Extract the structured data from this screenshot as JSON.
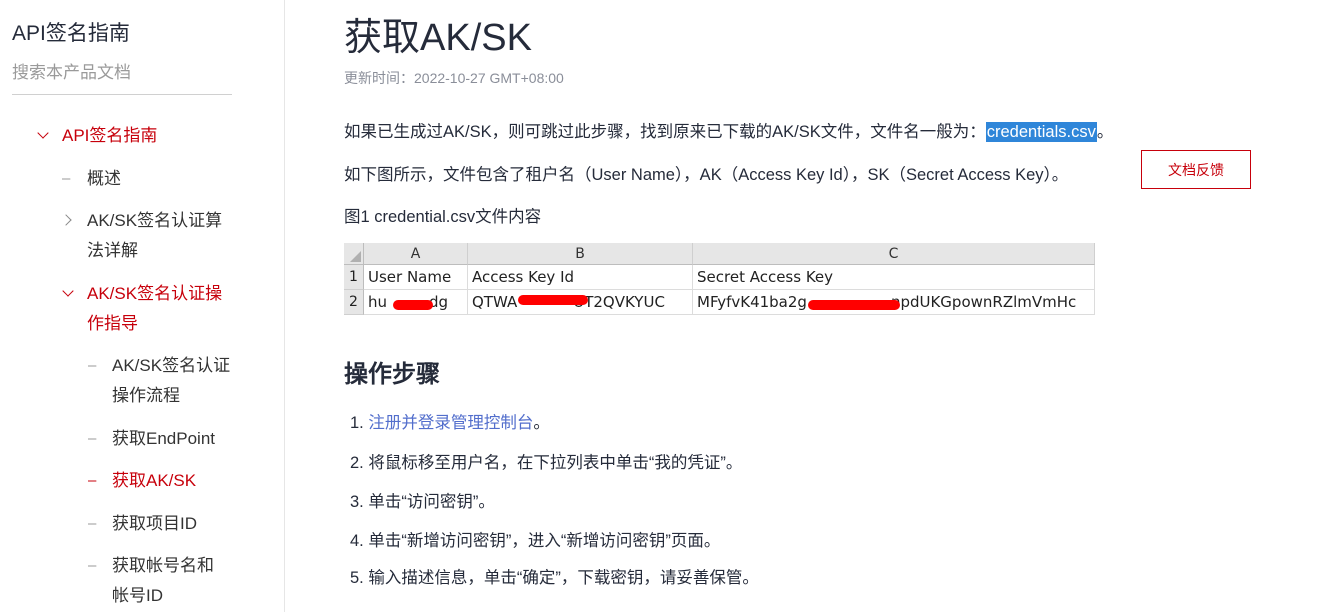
{
  "sidebar": {
    "title": "API签名指南",
    "search_placeholder": "搜索本产品文档",
    "items": [
      {
        "label": "API签名指南",
        "state": "expanded-active"
      },
      {
        "label": "概述"
      },
      {
        "label": "AK/SK签名认证算法详解",
        "line1": "AK/SK签名认证算",
        "line2": "法详解",
        "state": "collapsed"
      },
      {
        "label": "AK/SK签名认证操作指导",
        "line1": "AK/SK签名认证操",
        "line2": "作指导",
        "state": "expanded-active"
      },
      {
        "label": "AK/SK签名认证操作流程",
        "line1": "AK/SK签名认证",
        "line2": "操作流程"
      },
      {
        "label": "获取EndPoint"
      },
      {
        "label": "获取AK/SK",
        "state": "current"
      },
      {
        "label": "获取项目ID"
      },
      {
        "label": "获取帐号名和帐号ID",
        "line1": "获取帐号名和",
        "line2": "帐号ID"
      }
    ]
  },
  "main": {
    "title": "获取AK/SK",
    "updated": "更新时间：2022-10-27 GMT+08:00",
    "para1_before": "如果已生成过AK/SK，则可跳过此步骤，找到原来已下载的AK/SK文件，文件名一般为：",
    "para1_highlight": "credentials.csv",
    "para1_after": "。",
    "para2": "如下图所示，文件包含了租户名（User Name），AK（Access Key Id），SK（Secret Access Key）。",
    "feedback_label": "文档反馈",
    "figure_caption": "图1 credential.csv文件内容",
    "sheet": {
      "columns": [
        "A",
        "B",
        "C"
      ],
      "row_numbers": [
        "1",
        "2"
      ],
      "headers": [
        "User Name",
        "Access Key Id",
        "Secret Access Key"
      ],
      "row2": [
        "hu",
        "dg",
        "QTWA",
        "UT2QVKYUC",
        "MFyfvK41ba2g",
        "npdUKGpownRZlmVmHc"
      ]
    },
    "section_title": "操作步骤",
    "steps": [
      {
        "num": "1.",
        "link": "注册并登录管理控制台",
        "text": "。"
      },
      {
        "num": "2.",
        "text": "将鼠标移至用户名，在下拉列表中单击“我的凭证”。"
      },
      {
        "num": "3.",
        "text": "单击“访问密钥”。"
      },
      {
        "num": "4.",
        "text": "单击“新增访问密钥”，进入“新增访问密钥”页面。"
      },
      {
        "num": "5.",
        "text": "输入描述信息，单击“确定”，下载密钥，请妥善保管。"
      }
    ]
  },
  "colors": {
    "accent_red": "#c7000b",
    "link_blue": "#526ecc",
    "highlight": "#2f86d9"
  }
}
